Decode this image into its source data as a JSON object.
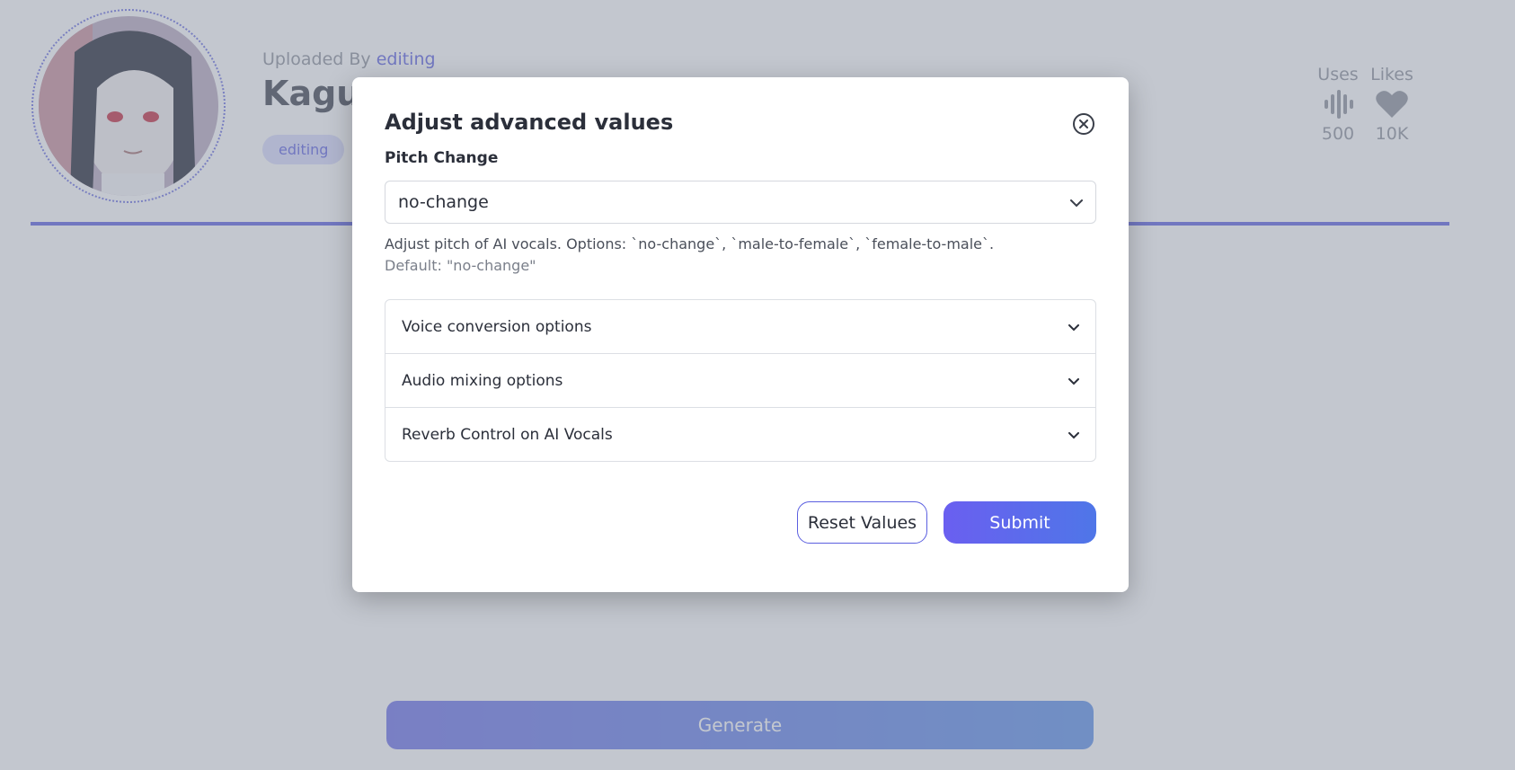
{
  "header": {
    "uploaded_prefix": "Uploaded By",
    "uploader": "editing",
    "title": "Kaguya",
    "tag": "editing"
  },
  "stats": {
    "uses_label": "Uses",
    "uses_value": "500",
    "likes_label": "Likes",
    "likes_value": "10K"
  },
  "main": {
    "generate_label": "Generate"
  },
  "modal": {
    "title": "Adjust advanced values",
    "pitch_label": "Pitch Change",
    "pitch_value": "no-change",
    "help_text": "Adjust pitch of AI vocals. Options: `no-change`, `male-to-female`, `female-to-male`.",
    "help_default": "Default: \"no-change\"",
    "accordion": [
      {
        "label": "Voice conversion options"
      },
      {
        "label": "Audio mixing options"
      },
      {
        "label": "Reverb Control on AI Vocals"
      }
    ],
    "reset_label": "Reset Values",
    "submit_label": "Submit"
  },
  "colors": {
    "accent": "#5b5fe0",
    "overlay": "rgba(135,143,160,0.5)"
  }
}
